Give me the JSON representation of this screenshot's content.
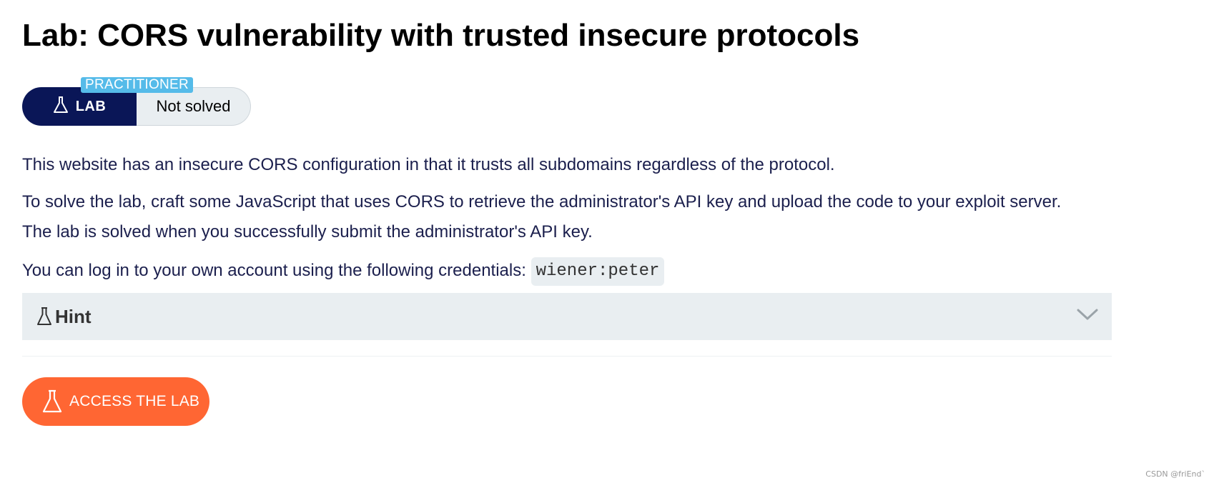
{
  "title": "Lab: CORS vulnerability with trusted insecure protocols",
  "status": {
    "lab_label": "LAB",
    "level": "PRACTITIONER",
    "solved_state": "Not solved",
    "icon": "flask-icon"
  },
  "description": {
    "line1": "This website has an insecure CORS configuration in that it trusts all subdomains regardless of the protocol.",
    "line2": "To solve the lab, craft some JavaScript that uses CORS to retrieve the administrator's API key and upload the code to your exploit server.",
    "line3": "The lab is solved when you successfully submit the administrator's API key.",
    "credentials_text": "You can log in to your own account using the following credentials:",
    "credentials_value": "wiener:peter"
  },
  "hint": {
    "label": "Hint",
    "icon": "flask-icon",
    "toggle_icon": "chevron-down-icon"
  },
  "access_button": {
    "label": "ACCESS THE LAB",
    "icon": "flask-icon"
  },
  "watermark": "CSDN @friEnd`",
  "colors": {
    "navy": "#0a1657",
    "accent_orange": "#ff6633",
    "badge_blue": "#55bbe9",
    "panel_gray": "#e9eef1",
    "text": "#1b1f4d"
  }
}
